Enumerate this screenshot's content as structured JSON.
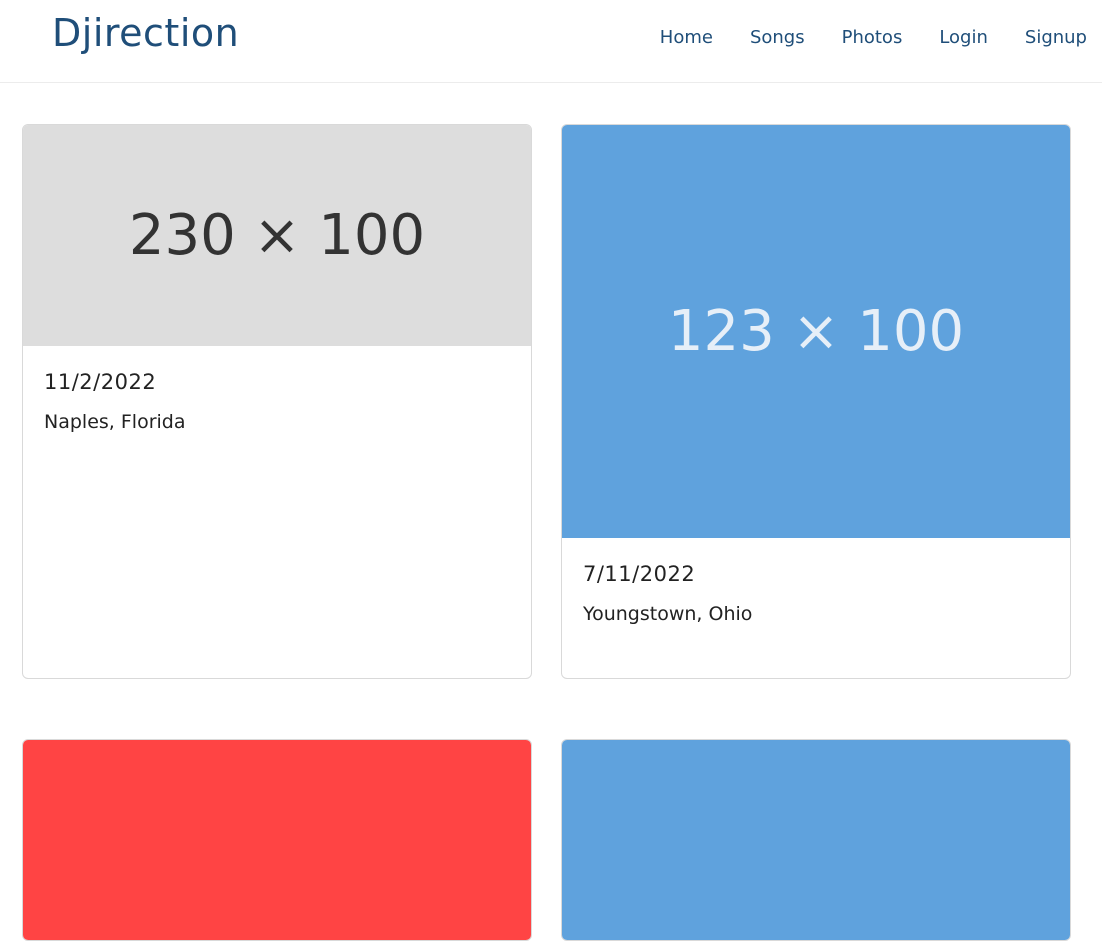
{
  "brand": "Djirection",
  "nav": [
    "Home",
    "Songs",
    "Photos",
    "Login",
    "Signup"
  ],
  "cards": [
    {
      "image_label": "230 × 100",
      "image_color": "#dddddd",
      "image_text_color": "#333333",
      "date": "11/2/2022",
      "place": "Naples, Florida"
    },
    {
      "image_label": "123 × 100",
      "image_color": "#5fa2dd",
      "image_text_color": "#e6eff8",
      "date": "7/11/2022",
      "place": "Youngstown, Ohio"
    },
    {
      "image_color": "#ff4444"
    },
    {
      "image_color": "#5fa2dd"
    }
  ]
}
